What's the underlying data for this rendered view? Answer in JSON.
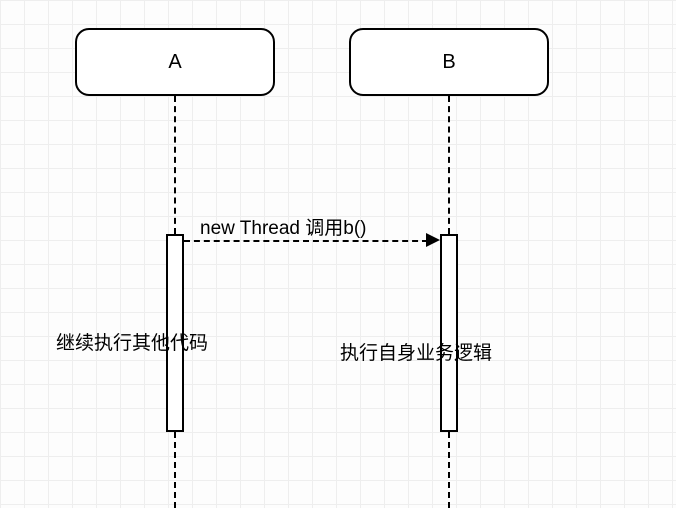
{
  "participants": {
    "a": {
      "label": "A"
    },
    "b": {
      "label": "B"
    }
  },
  "message": {
    "label": "new Thread 调用b()"
  },
  "notes": {
    "a": "继续执行其他代码",
    "b": "执行自身业务逻辑"
  }
}
